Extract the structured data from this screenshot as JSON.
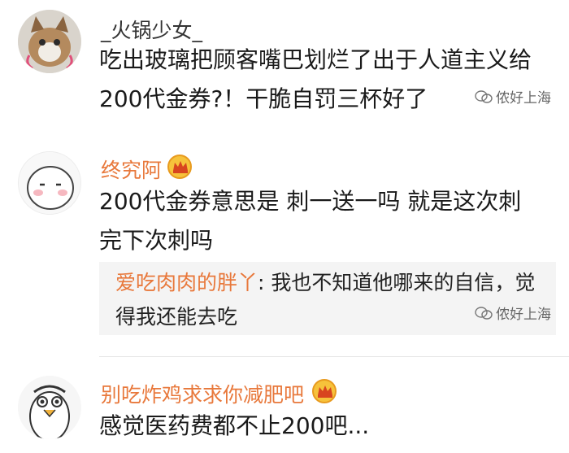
{
  "comments": [
    {
      "username": "_火锅少女_",
      "lines": [
        "吃出玻璃把顾客嘴巴划烂了出于人道主义给",
        "200代金券?！干脆自罚三杯好了"
      ],
      "watermark": "侬好上海"
    },
    {
      "username": "终究阿",
      "lines": [
        "200代金券意思是 刺一送一吗 就是这次刺",
        "完下次刺吗"
      ],
      "reply": {
        "user": "爱吃肉肉的胖丫",
        "line1": "我也不知道他哪来的自信，觉",
        "line2": "得我还能去吃"
      },
      "watermark": "侬好上海"
    },
    {
      "username": "别吃炸鸡求求你减肥吧",
      "lines": [
        "感觉医药费都不止200吧..."
      ]
    }
  ],
  "colors": {
    "vip_name": "#e8783b",
    "crown": "#f6c23b",
    "reply_bg": "#f4f4f4"
  }
}
